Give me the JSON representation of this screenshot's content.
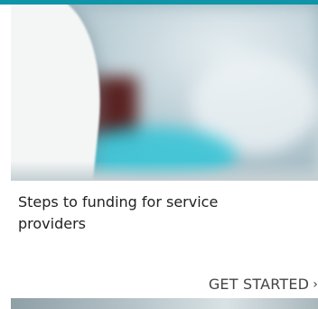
{
  "card": {
    "title": "Steps to funding for service providers",
    "cta_label": "GET STARTED",
    "cta_icon": "chevron-right-icon",
    "cta_icon_glyph": "›"
  },
  "colors": {
    "accent": "#0f95a8",
    "title_text": "#222222",
    "cta_text": "#444444"
  }
}
